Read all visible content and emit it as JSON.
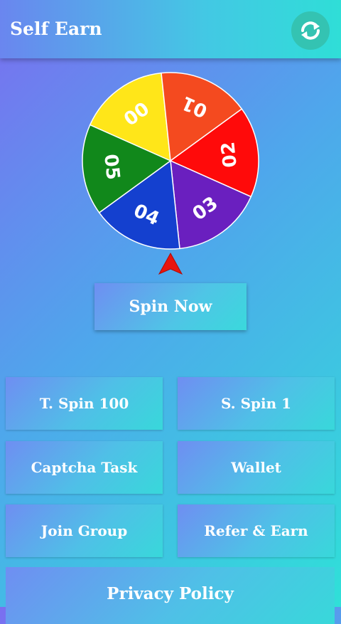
{
  "app": {
    "title": "Self Earn",
    "refresh_icon": "refresh-icon"
  },
  "wheel": {
    "segments": [
      {
        "label": "00",
        "color": "#ffe619"
      },
      {
        "label": "01",
        "color": "#f44a1f"
      },
      {
        "label": "02",
        "color": "#ff0a0a"
      },
      {
        "label": "03",
        "color": "#6a1fbf"
      },
      {
        "label": "04",
        "color": "#1440cf"
      },
      {
        "label": "05",
        "color": "#11881b"
      }
    ],
    "pointer_color": "#e8150f"
  },
  "spin_button": {
    "label": "Spin Now"
  },
  "menu": {
    "t_spin": "T. Spin 100",
    "s_spin": "S. Spin 1",
    "captcha": "Captcha Task",
    "wallet": "Wallet",
    "join_group": "Join Group",
    "refer": "Refer & Earn",
    "privacy": "Privacy Policy"
  },
  "colors": {
    "accent": "#34c3b2",
    "text": "#ffffff"
  }
}
